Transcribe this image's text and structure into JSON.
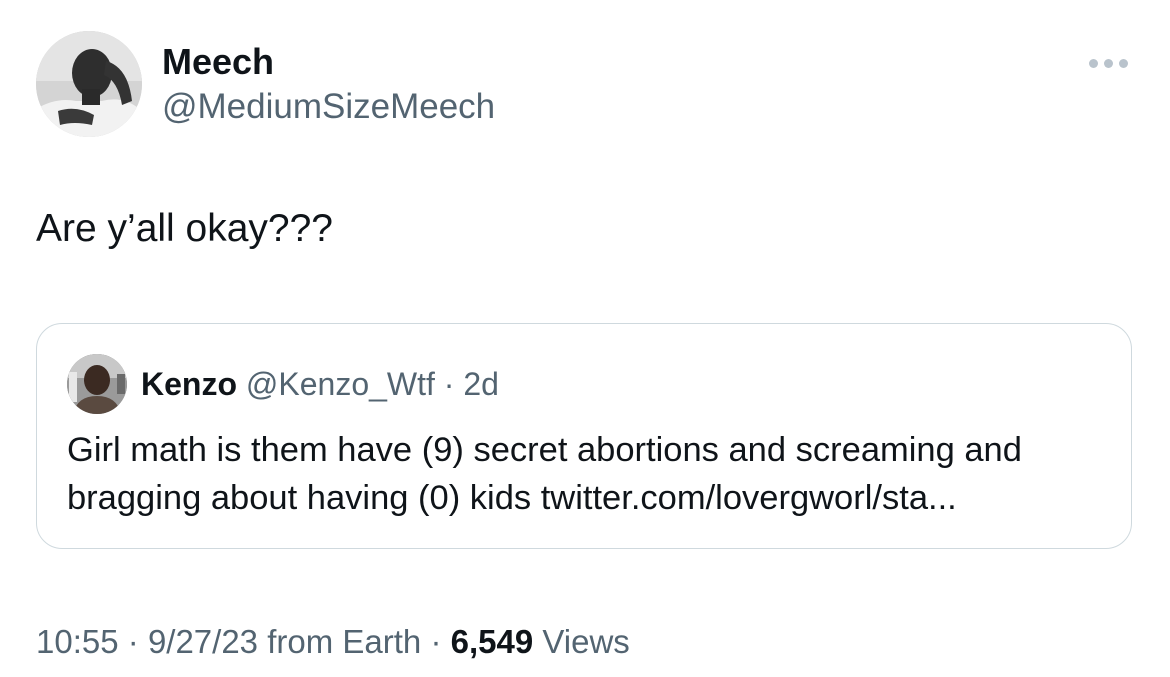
{
  "author": {
    "name": "Meech",
    "handle": "@MediumSizeMeech",
    "avatar_icon": "person-photo-avatar"
  },
  "more_icon": "ellipsis-icon",
  "tweet": {
    "text": "Are y’all okay???"
  },
  "quoted_tweet": {
    "name": "Kenzo",
    "handle": "@Kenzo_Wtf",
    "separator": "·",
    "age": "2d",
    "avatar_icon": "person-photo-avatar",
    "text_lines": [
      "Girl math is them have (9) secret abortions and screaming and",
      "bragging about having  (0) kids twitter.com/lovergworl/sta..."
    ]
  },
  "footer": {
    "time": "10:55",
    "separator": "·",
    "date": "9/27/23",
    "source": "from Earth",
    "views_count": "6,549",
    "views_label": "Views"
  },
  "colors": {
    "text_primary": "#0f1419",
    "text_secondary": "#536471",
    "border": "#cfd9de",
    "dots": "#b9c3cc"
  }
}
